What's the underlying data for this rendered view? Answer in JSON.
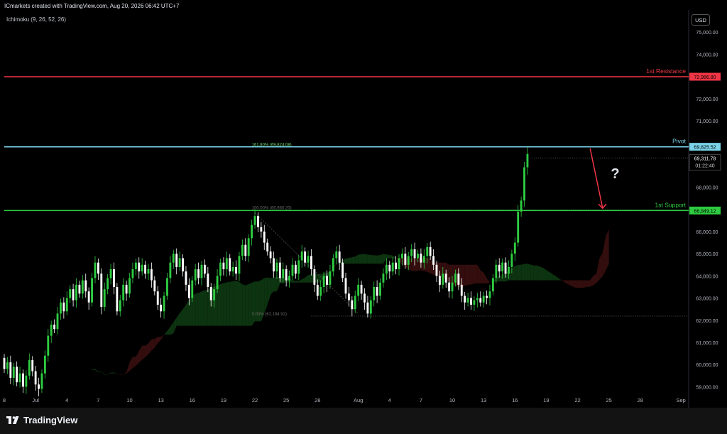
{
  "header": {
    "credit": "ICmarkets created with TradingView.com, Aug 20, 2026 06:42 UTC+7",
    "indicator": "Ichimoku (9, 26, 52, 26)",
    "currency": "USD"
  },
  "footer": {
    "brand": "TradingView"
  },
  "colors": {
    "resistance": "#f23645",
    "pivot": "#7ad3e8",
    "support": "#2ecc40",
    "up_candle": "#2ecc40",
    "down_candle": "#ffffff",
    "cloud_bull": "#0e3a12",
    "cloud_bear": "#3a0f0f",
    "arrow": "#f23645",
    "axis_text": "#b2b5be"
  },
  "chart_data": {
    "type": "candlestick",
    "symbol_currency": "USD",
    "ylim": [
      58500,
      76000
    ],
    "y_ticks": [
      59000,
      60000,
      61000,
      62000,
      63000,
      64000,
      65000,
      66000,
      67000,
      68000,
      69000,
      70000,
      71000,
      72000,
      73000,
      74000,
      75000
    ],
    "y_tick_labels": [
      "59,000.00",
      "60,000.00",
      "61,000.00",
      "62,000.00",
      "63,000.00",
      "64,000.00",
      "65,000.00",
      "66,000.00",
      "67,000.00",
      "68,000.00",
      "69,000.00",
      "70,000.00",
      "71,000.00",
      "72,000.00",
      "73,000.00",
      "74,000.00",
      "75,000.00"
    ],
    "x_ticks": [
      {
        "label": "8",
        "index": 0
      },
      {
        "label": "Jul",
        "index": 10
      },
      {
        "label": "4",
        "index": 20
      },
      {
        "label": "7",
        "index": 30
      },
      {
        "label": "10",
        "index": 40
      },
      {
        "label": "13",
        "index": 50
      },
      {
        "label": "16",
        "index": 60
      },
      {
        "label": "19",
        "index": 70
      },
      {
        "label": "22",
        "index": 80
      },
      {
        "label": "25",
        "index": 90
      },
      {
        "label": "28",
        "index": 100
      },
      {
        "label": "Aug",
        "index": 113
      },
      {
        "label": "4",
        "index": 123
      },
      {
        "label": "7",
        "index": 133
      },
      {
        "label": "10",
        "index": 143
      },
      {
        "label": "13",
        "index": 153
      },
      {
        "label": "16",
        "index": 163
      },
      {
        "label": "19",
        "index": 173
      },
      {
        "label": "22",
        "index": 183
      },
      {
        "label": "25",
        "index": 193
      },
      {
        "label": "28",
        "index": 203
      },
      {
        "label": "Sep",
        "index": 216
      }
    ],
    "x_index_range": [
      0,
      218
    ],
    "levels": [
      {
        "name": "1st Resistance",
        "value": 72986.8,
        "label": "72,986.80",
        "role": "resistance"
      },
      {
        "name": "Pivot",
        "value": 69825.52,
        "label": "69,825.52",
        "role": "pivot"
      },
      {
        "name": "1st Support",
        "value": 66949.12,
        "label": "66,949.12",
        "role": "support"
      }
    ],
    "fib_levels": [
      {
        "text": "161.80% (69,824.08)",
        "value": 69824.08
      },
      {
        "text": "100.00% (66,980.20)",
        "value": 66980.2
      },
      {
        "text": "0.00% (62,184.92)",
        "value": 62184.92
      }
    ],
    "current_price": {
      "value": 69311.78,
      "label": "69,311.78",
      "countdown": "01:22:40"
    },
    "annotation": {
      "text": "?",
      "arrow_from": [
        187,
        69750
      ],
      "arrow_to": [
        191,
        67050
      ]
    },
    "candles": [
      [
        60.3,
        59.8
      ],
      [
        59.8,
        60.1
      ],
      [
        60.1,
        59.4
      ],
      [
        59.4,
        59.9
      ],
      [
        59.9,
        59.2
      ],
      [
        59.2,
        59.6
      ],
      [
        59.6,
        59.0
      ],
      [
        59.0,
        59.5
      ],
      [
        59.5,
        60.2
      ],
      [
        60.2,
        59.7
      ],
      [
        59.7,
        59.1
      ],
      [
        59.1,
        58.9
      ],
      [
        58.9,
        59.6
      ],
      [
        59.6,
        60.4
      ],
      [
        60.4,
        61.3
      ],
      [
        61.3,
        61.8
      ],
      [
        61.8,
        61.6
      ],
      [
        61.6,
        62.3
      ],
      [
        62.3,
        62.8
      ],
      [
        62.8,
        62.4
      ],
      [
        62.4,
        63.0
      ],
      [
        63.0,
        63.4
      ],
      [
        63.4,
        62.9
      ],
      [
        62.9,
        63.6
      ],
      [
        63.6,
        63.2
      ],
      [
        63.2,
        63.8
      ],
      [
        63.8,
        63.3
      ],
      [
        63.3,
        62.8
      ],
      [
        62.8,
        63.9
      ],
      [
        63.9,
        64.6
      ],
      [
        64.6,
        64.1
      ],
      [
        64.1,
        62.6
      ],
      [
        62.6,
        63.4
      ],
      [
        63.4,
        63.9
      ],
      [
        63.9,
        64.3
      ],
      [
        64.3,
        63.5
      ],
      [
        63.5,
        62.4
      ],
      [
        62.4,
        62.9
      ],
      [
        62.9,
        63.6
      ],
      [
        63.6,
        63.2
      ],
      [
        63.2,
        63.9
      ],
      [
        63.9,
        64.3
      ],
      [
        64.3,
        64.6
      ],
      [
        64.6,
        64.2
      ],
      [
        64.2,
        64.5
      ],
      [
        64.5,
        64.1
      ],
      [
        64.1,
        64.3
      ],
      [
        64.3,
        63.8
      ],
      [
        63.8,
        63.3
      ],
      [
        63.3,
        62.7
      ],
      [
        62.7,
        62.4
      ],
      [
        62.4,
        63.1
      ],
      [
        63.1,
        63.9
      ],
      [
        63.9,
        64.6
      ],
      [
        64.6,
        65.0
      ],
      [
        65.0,
        64.4
      ],
      [
        64.4,
        64.8
      ],
      [
        64.8,
        64.2
      ],
      [
        64.2,
        63.6
      ],
      [
        63.6,
        63.0
      ],
      [
        63.0,
        63.8
      ],
      [
        63.8,
        64.3
      ],
      [
        64.3,
        63.9
      ],
      [
        63.9,
        64.5
      ],
      [
        64.5,
        64.1
      ],
      [
        64.1,
        63.5
      ],
      [
        63.5,
        62.9
      ],
      [
        62.9,
        63.4
      ],
      [
        63.4,
        64.0
      ],
      [
        64.0,
        64.6
      ],
      [
        64.6,
        64.3
      ],
      [
        64.3,
        64.8
      ],
      [
        64.8,
        64.2
      ],
      [
        64.2,
        64.4
      ],
      [
        64.4,
        64.1
      ],
      [
        64.1,
        64.9
      ],
      [
        64.9,
        65.4
      ],
      [
        65.4,
        64.9
      ],
      [
        64.9,
        65.7
      ],
      [
        65.7,
        66.3
      ],
      [
        66.3,
        66.7
      ],
      [
        66.7,
        66.2
      ],
      [
        66.2,
        66.0
      ],
      [
        66.0,
        65.5
      ],
      [
        65.5,
        65.1
      ],
      [
        65.1,
        64.8
      ],
      [
        64.8,
        64.2
      ],
      [
        64.2,
        64.6
      ],
      [
        64.6,
        63.9
      ],
      [
        63.9,
        64.3
      ],
      [
        64.3,
        63.8
      ],
      [
        63.8,
        64.0
      ],
      [
        64.0,
        64.5
      ],
      [
        64.5,
        64.1
      ],
      [
        64.1,
        64.7
      ],
      [
        64.7,
        65.1
      ],
      [
        65.1,
        64.6
      ],
      [
        64.6,
        64.9
      ],
      [
        64.9,
        64.3
      ],
      [
        64.3,
        63.6
      ],
      [
        63.6,
        63.1
      ],
      [
        63.1,
        63.5
      ],
      [
        63.5,
        64.0
      ],
      [
        64.0,
        63.6
      ],
      [
        63.6,
        64.2
      ],
      [
        64.2,
        64.8
      ],
      [
        64.8,
        65.1
      ],
      [
        65.1,
        64.6
      ],
      [
        64.6,
        63.9
      ],
      [
        63.9,
        63.2
      ],
      [
        63.2,
        62.9
      ],
      [
        62.9,
        62.5
      ],
      [
        62.5,
        63.1
      ],
      [
        63.1,
        63.6
      ],
      [
        63.6,
        63.2
      ],
      [
        63.2,
        62.8
      ],
      [
        62.8,
        62.3
      ],
      [
        62.3,
        62.9
      ],
      [
        62.9,
        63.5
      ],
      [
        63.5,
        63.1
      ],
      [
        63.1,
        63.7
      ],
      [
        63.7,
        64.1
      ],
      [
        64.1,
        64.5
      ],
      [
        64.5,
        64.2
      ],
      [
        64.2,
        64.6
      ],
      [
        64.6,
        64.3
      ],
      [
        64.3,
        64.8
      ],
      [
        64.8,
        65.0
      ],
      [
        65.0,
        64.5
      ],
      [
        64.5,
        64.9
      ],
      [
        64.9,
        65.2
      ],
      [
        65.2,
        64.8
      ],
      [
        64.8,
        65.0
      ],
      [
        65.0,
        64.6
      ],
      [
        64.6,
        64.9
      ],
      [
        64.9,
        65.3
      ],
      [
        65.3,
        64.9
      ],
      [
        64.9,
        64.5
      ],
      [
        64.5,
        64.0
      ],
      [
        64.0,
        63.6
      ],
      [
        63.6,
        64.1
      ],
      [
        64.1,
        63.7
      ],
      [
        63.7,
        63.3
      ],
      [
        63.3,
        63.7
      ],
      [
        63.7,
        64.1
      ],
      [
        64.1,
        63.6
      ],
      [
        63.6,
        63.1
      ],
      [
        63.1,
        62.8
      ],
      [
        62.8,
        63.0
      ],
      [
        63.0,
        62.7
      ],
      [
        62.7,
        62.9
      ],
      [
        62.9,
        63.0
      ],
      [
        63.0,
        62.8
      ],
      [
        62.8,
        63.1
      ],
      [
        63.1,
        63.0
      ],
      [
        63.0,
        63.3
      ],
      [
        63.3,
        63.9
      ],
      [
        63.9,
        64.5
      ],
      [
        64.5,
        64.2
      ],
      [
        64.2,
        64.6
      ],
      [
        64.6,
        64.1
      ],
      [
        64.1,
        64.4
      ],
      [
        64.4,
        65.0
      ],
      [
        65.0,
        65.5
      ],
      [
        65.5,
        66.9
      ],
      [
        66.9,
        67.4
      ],
      [
        67.4,
        68.9
      ],
      [
        68.9,
        69.5
      ]
    ]
  }
}
